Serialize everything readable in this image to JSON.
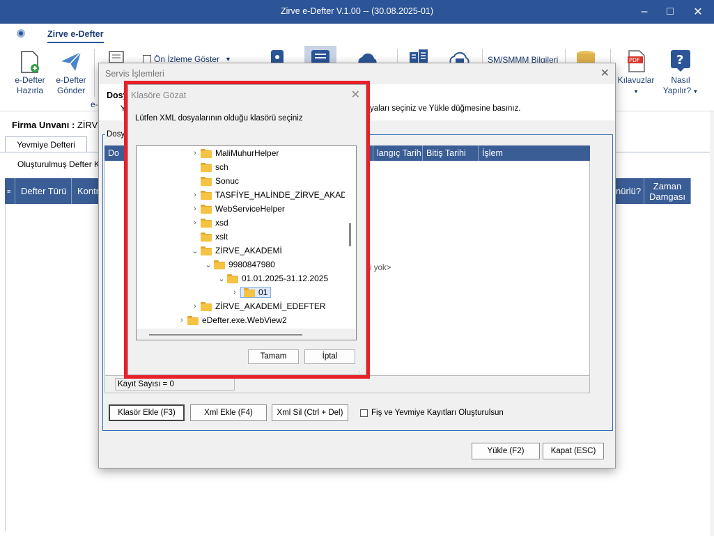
{
  "window": {
    "title": "Zirve e-Defter V.1.00  -- (30.08.2025-01)"
  },
  "ribbon": {
    "tab": "Zirve e-Defter",
    "buttons": {
      "hazirla": "e-Defter\nHazırla",
      "gonder": "e-Defter\nGönder",
      "onizleme": "Ön İzleme Göster",
      "sm_smmm": "SM/SMMM Bilgileri",
      "kilavuzlar": "Kılavuzlar",
      "nasil": "Nasıl\nYapılır?",
      "partial_e": "e-"
    }
  },
  "main": {
    "firma_label": "Firma Unvanı :",
    "firma_value": "ZİRV",
    "tab": "Yevmiye Defteri",
    "olusturulmus": "Oluşturulmuş Defter Kay",
    "columns": [
      "Defter Türü",
      "Kontr"
    ],
    "right_columns": [
      "nürlü?",
      "Zaman\nDamgası"
    ]
  },
  "servis": {
    "title": "Servis İşlemleri",
    "bold_label": "Dosy",
    "info_text": "yaları seçiniz ve Yükle düğmesine basınız.",
    "info_prefix": "Y",
    "group_label": "Dosy",
    "grid_columns": [
      "Do",
      "langıç Tarih",
      "Bitiş Tarihi",
      "İşlem"
    ],
    "empty_text": "i yok>",
    "record_count": "Kayıt Sayısı = 0",
    "buttons": {
      "klasor_ekle": "Klasör Ekle (F3)",
      "xml_ekle": "Xml Ekle (F4)",
      "xml_sil": "Xml Sil (Ctrl + Del)",
      "yukle": "Yükle (F2)",
      "kapat": "Kapat (ESC)"
    },
    "checkbox_label": "Fiş ve Yevmiye Kayıtları Oluşturulsun"
  },
  "klasor": {
    "title": "Klasöre Gözat",
    "prompt": "Lütfen XML dosyalarının olduğu klasörü seçiniz",
    "tree": [
      {
        "label": "MaliMuhurHelper",
        "chev": "›"
      },
      {
        "label": "sch",
        "chev": ""
      },
      {
        "label": "Sonuc",
        "chev": ""
      },
      {
        "label": "TASFİYE_HALİNDE_ZİRVE_AKADEMİ",
        "chev": "›"
      },
      {
        "label": "WebServiceHelper",
        "chev": "›"
      },
      {
        "label": "xsd",
        "chev": "›"
      },
      {
        "label": "xslt",
        "chev": ""
      },
      {
        "label": "ZİRVE_AKADEMİ",
        "chev": "⌄"
      },
      {
        "label": "9980847980",
        "chev": "⌄"
      },
      {
        "label": "01.01.2025-31.12.2025",
        "chev": "⌄"
      },
      {
        "label": "01",
        "chev": "›"
      },
      {
        "label": "ZİRVE_AKADEMİ_EDEFTER",
        "chev": "›"
      },
      {
        "label": "eDefter.exe.WebView2",
        "chev": "›"
      }
    ],
    "ok": "Tamam",
    "cancel": "İptal"
  }
}
